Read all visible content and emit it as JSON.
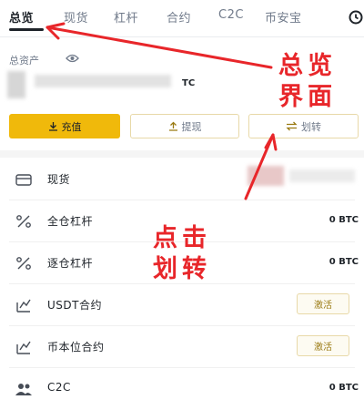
{
  "tabs": [
    {
      "label": "总览",
      "active": true
    },
    {
      "label": "现货"
    },
    {
      "label": "杠杆"
    },
    {
      "label": "合约"
    },
    {
      "label": "C2C"
    },
    {
      "label": "币安宝"
    }
  ],
  "overview": {
    "total_assets_label": "总资产",
    "value_tail": "TC"
  },
  "actions": {
    "deposit": "充值",
    "withdraw": "提现",
    "transfer": "划转"
  },
  "accounts": [
    {
      "label": "现货",
      "icon": "wallet-icon",
      "value": ""
    },
    {
      "label": "全仓杠杆",
      "icon": "percent-icon",
      "value": "0 BTC"
    },
    {
      "label": "逐仓杠杆",
      "icon": "percent-icon",
      "value": "0 BTC"
    },
    {
      "label": "USDT合约",
      "icon": "contract-icon",
      "button": "激活"
    },
    {
      "label": "币本位合约",
      "icon": "contract-icon",
      "button": "激活"
    },
    {
      "label": "C2C",
      "icon": "users-icon",
      "value": "0 BTC"
    }
  ],
  "annotations": {
    "overview_line1": "总览",
    "overview_line2": "界面",
    "click_line1": "点击",
    "click_line2": "划转"
  },
  "colors": {
    "accent": "#f0b90b",
    "annotation": "#e8262a"
  }
}
